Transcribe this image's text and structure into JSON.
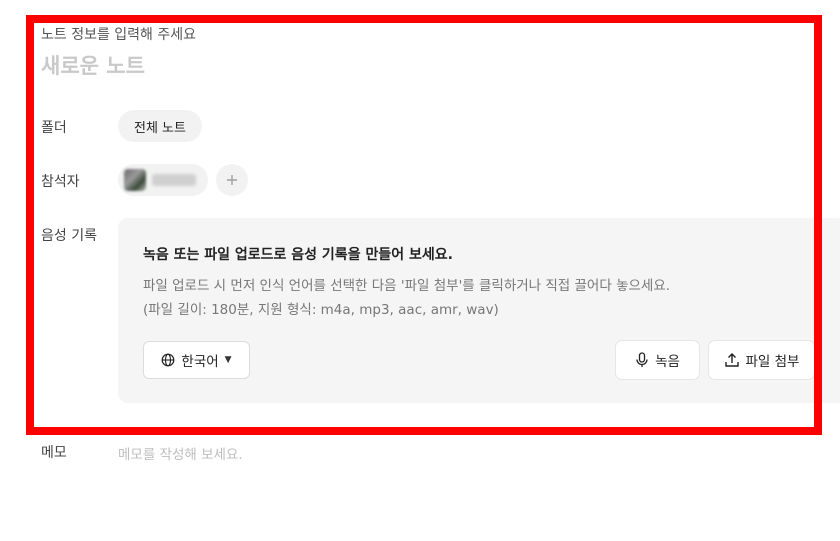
{
  "form": {
    "hint": "노트 정보를 입력해 주세요",
    "title_placeholder": "새로운 노트"
  },
  "folder": {
    "label": "폴더",
    "value": "전체 노트"
  },
  "participants": {
    "label": "참석자",
    "add_icon": "plus-icon"
  },
  "voice": {
    "label": "음성 기록",
    "heading": "녹음 또는 파일 업로드로 음성 기록을 만들어 보세요.",
    "description": "파일 업로드 시 먼저 인식 언어를 선택한 다음 '파일 첨부'를 클릭하거나 직접 끌어다 놓으세요.",
    "formats": "(파일 길이: 180분, 지원 형식: m4a, mp3, aac, amr, wav)",
    "language": "한국어",
    "record_label": "녹음",
    "upload_label": "파일 첨부"
  },
  "memo": {
    "label": "메모",
    "placeholder": "메모를 작성해 보세요."
  },
  "colors": {
    "highlight": "#ff0000",
    "card_bg": "#f5f5f5"
  }
}
